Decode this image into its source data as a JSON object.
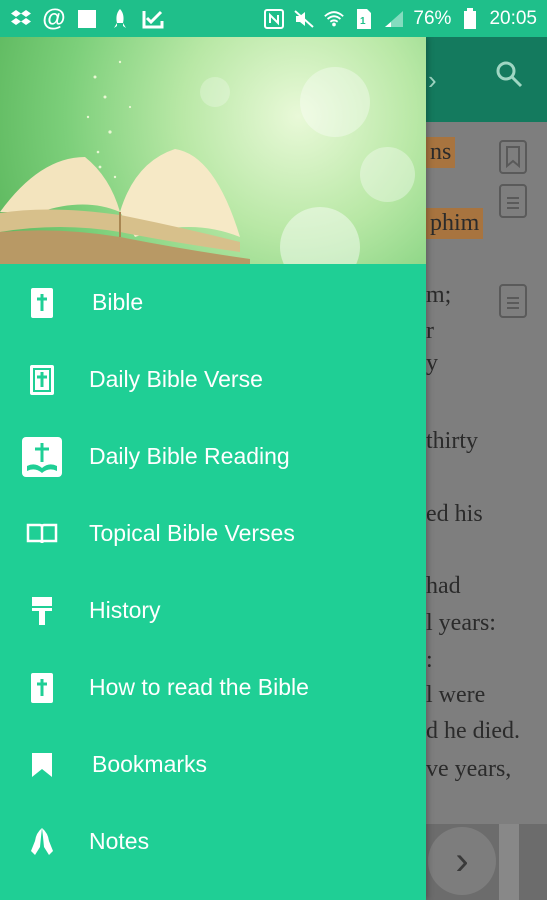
{
  "status_bar": {
    "battery": "76%",
    "time": "20:05"
  },
  "background": {
    "lines": [
      "ns",
      "phim",
      "m;",
      "r",
      "y",
      "thirty",
      "ed his",
      "had",
      "l years:",
      ":",
      "l were",
      "d he died.",
      "ve years,"
    ]
  },
  "drawer": {
    "menu": [
      {
        "label": "Bible",
        "icon": "bible-icon"
      },
      {
        "label": "Daily Bible Verse",
        "icon": "calendar-book-icon"
      },
      {
        "label": "Daily Bible Reading",
        "icon": "cross-book-icon"
      },
      {
        "label": "Topical Bible Verses",
        "icon": "open-book-icon"
      },
      {
        "label": "History",
        "icon": "paint-roller-icon"
      },
      {
        "label": "How to read the Bible",
        "icon": "bible-icon"
      },
      {
        "label": "Bookmarks",
        "icon": "bookmark-icon"
      },
      {
        "label": "Notes",
        "icon": "praying-hands-icon"
      }
    ]
  },
  "colors": {
    "drawer_bg": "#1fcf95",
    "status_bar_bg": "#1fbf8a",
    "highlight": "#a8743f"
  }
}
